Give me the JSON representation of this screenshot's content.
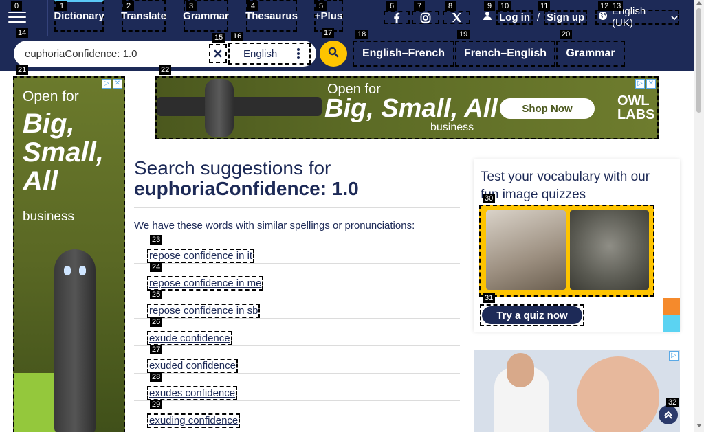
{
  "nav": {
    "items": [
      {
        "label": "Dictionary"
      },
      {
        "label": "Translate"
      },
      {
        "label": "Grammar"
      },
      {
        "label": "Thesaurus"
      },
      {
        "label": "+Plus"
      }
    ]
  },
  "header": {
    "login": "Log in",
    "signup": "Sign up",
    "separator": "/",
    "language": "English (UK)"
  },
  "search": {
    "value": "euphoriaConfidence: 1.0",
    "dictionary": "English",
    "pills": [
      "English–French",
      "French–English",
      "Grammar"
    ]
  },
  "badges": [
    "0",
    "1",
    "2",
    "3",
    "4",
    "5",
    "6",
    "7",
    "8",
    "9",
    "10",
    "11",
    "12",
    "13",
    "14",
    "15",
    "16",
    "17",
    "18",
    "19",
    "20",
    "21",
    "22",
    "23",
    "24",
    "25",
    "26",
    "27",
    "28",
    "29",
    "30",
    "31",
    "32"
  ],
  "ads": {
    "side": {
      "line1": "Open for",
      "line2": "Big, Small, All",
      "line3": "business"
    },
    "top": {
      "line1": "Open for",
      "line2": "Big, Small, All",
      "line3": "business",
      "cta": "Shop Now",
      "brand": "OWL LABS"
    }
  },
  "main": {
    "title_prefix": "Search suggestions for",
    "query": "euphoriaConfidence: 1.0",
    "intro": "We have these words with similar spellings or pronunciations:",
    "suggestions": [
      "repose confidence in it",
      "repose confidence in me",
      "repose confidence in sb",
      "exude confidence",
      "exuded confidence",
      "exudes confidence",
      "exuding confidence"
    ]
  },
  "quiz": {
    "title": "Test your vocabulary with our fun image quizzes",
    "button": "Try a quiz now"
  },
  "colors": {
    "brand_navy": "#1d2a57",
    "accent_yellow": "#fec400",
    "accent_cyan": "#5bc8f5",
    "accent_orange": "#f58a2c"
  }
}
